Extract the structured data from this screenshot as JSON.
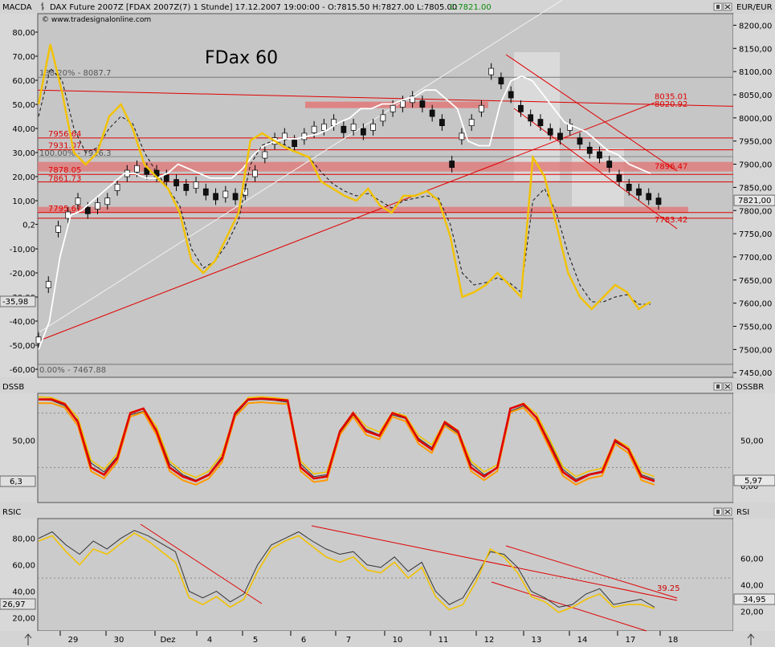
{
  "window": {
    "title_left": "MACDA",
    "title": "DAX Future 2007Z [FDAX 2007Z(7)  1 Stunde] 17.12.2007 19:00:00 - O:7815.50 H:7827.00 L:7805.00",
    "close_label": "C:7821.00",
    "website": "© www.tradesignalonline.com",
    "chart_label": "FDax 60",
    "right_header": "EUR/EUR"
  },
  "colors": {
    "price_bg": "#c6c6c6",
    "panel_bg": "#cbcbcb",
    "axis_bg": "#d8d8d8",
    "yellow": "#f2c200",
    "orange": "#ff9a00",
    "red": "#e00000",
    "white": "#ffffff",
    "black": "#000000",
    "band": "#e07878"
  },
  "chart_data": [
    {
      "type": "line",
      "panel": "price",
      "left_axis": [
        "80,00",
        "70,00",
        "60,00",
        "50,00",
        "40,00",
        "30,00",
        "20,00",
        "10,00",
        "0,2",
        "-10,00",
        "-20,00",
        "-30,00",
        "-40,00",
        "-50,00",
        "-60,00"
      ],
      "left_marker": "-35,98",
      "right_axis": [
        "8200,00",
        "8150,00",
        "8100,00",
        "8050,00",
        "8000,00",
        "7950,00",
        "7900,00",
        "7850,00",
        "7800,00",
        "7750,00",
        "7700,00",
        "7650,00",
        "7600,00",
        "7550,00",
        "7500,00",
        "7450,00"
      ],
      "right_marker": "7821,00",
      "ylim": [
        7440,
        8225
      ],
      "levels": [
        {
          "label": "138.20% - 8087.7",
          "value": 8087.7
        },
        {
          "label": "8035.01",
          "value": 8035.01
        },
        {
          "label": "8020.92",
          "value": 8020.92
        },
        {
          "label": "7956.64",
          "value": 7956.64
        },
        {
          "label": "7931.07",
          "value": 7931.07
        },
        {
          "label": "7896.47",
          "value": 7896.47
        },
        {
          "label": "100.00% - 7916.3",
          "value": 7916.3
        },
        {
          "label": "7878.05",
          "value": 7878.05
        },
        {
          "label": "7861.73",
          "value": 7861.73
        },
        {
          "label": "7795.67",
          "value": 7795.67
        },
        {
          "label": "7783.42",
          "value": 7783.42
        },
        {
          "label": "0.00% - 7467.88",
          "value": 7467.88
        }
      ],
      "series": [
        {
          "values": [
            7520,
            7640,
            7760,
            7790,
            7820,
            7800,
            7810,
            7820,
            7850,
            7880,
            7890,
            7885,
            7880,
            7870,
            7860,
            7850,
            7855,
            7840,
            7830,
            7835,
            7830,
            7840,
            7880,
            7920,
            7950,
            7960,
            7945,
            7960,
            7975,
            7980,
            7990,
            7975,
            7980,
            7970,
            7980,
            8000,
            8020,
            8030,
            8040,
            8030,
            8010,
            7990,
            7900,
            7960,
            7990,
            8020,
            8100,
            8080,
            8050,
            8020,
            8000,
            7990,
            7970,
            7960,
            7980,
            7950,
            7930,
            7920,
            7900,
            7870,
            7850,
            7840,
            7830,
            7820
          ]
        },
        {
          "values": [
            7500,
            7560,
            7700,
            7790,
            7800,
            7820,
            7840,
            7860,
            7880,
            7880,
            7870,
            7870,
            7880,
            7900,
            7890,
            7880,
            7870,
            7870,
            7870,
            7890,
            7920,
            7940,
            7950,
            7955,
            7955,
            7960,
            7965,
            7975,
            7990,
            8000,
            8020,
            8020,
            8030,
            8030,
            8040,
            8045,
            8060,
            8060,
            8040,
            8020,
            7950,
            7940,
            7940,
            8030,
            8080,
            8090,
            8080,
            8050,
            8020,
            7990,
            7980,
            7970,
            7950,
            7930,
            7920,
            7900,
            7890,
            7880
          ]
        },
        {
          "values": [
            50,
            75,
            55,
            30,
            25,
            30,
            45,
            50,
            40,
            25,
            20,
            15,
            5,
            -15,
            -20,
            -15,
            -5,
            5,
            35,
            38,
            35,
            32,
            30,
            28,
            18,
            15,
            12,
            10,
            15,
            8,
            5,
            12,
            12,
            14,
            10,
            -5,
            -30,
            -28,
            -25,
            -20,
            -25,
            -30,
            28,
            20,
            0,
            -20,
            -30,
            -35,
            -30,
            -25,
            -28,
            -35,
            -32
          ]
        },
        {
          "values": [
            45,
            65,
            60,
            40,
            30,
            32,
            40,
            45,
            42,
            30,
            22,
            15,
            8,
            -10,
            -18,
            -15,
            -8,
            2,
            25,
            33,
            35,
            33,
            30,
            28,
            22,
            17,
            14,
            12,
            13,
            10,
            7,
            10,
            11,
            12,
            11,
            0,
            -20,
            -25,
            -24,
            -22,
            -24,
            -28,
            10,
            15,
            5,
            -12,
            -25,
            -32,
            -32,
            -30,
            -29,
            -33,
            -33
          ]
        }
      ]
    },
    {
      "type": "line",
      "panel": "DSSB",
      "title": "DSSB",
      "right_title": "DSSBR",
      "left_axis": [
        "50,00"
      ],
      "left_marker": "6,3",
      "right_axis": [
        "50,00",
        "0,00"
      ],
      "right_marker": "5,97",
      "ylim": [
        0,
        100
      ],
      "series": [
        {
          "values": [
            95,
            95,
            90,
            70,
            20,
            12,
            30,
            80,
            85,
            60,
            20,
            10,
            5,
            12,
            30,
            80,
            95,
            96,
            95,
            94,
            20,
            8,
            10,
            60,
            80,
            60,
            55,
            80,
            75,
            50,
            40,
            70,
            60,
            20,
            10,
            20,
            85,
            90,
            75,
            45,
            15,
            5,
            12,
            15,
            50,
            40,
            10,
            5
          ]
        },
        {
          "values": [
            95,
            94,
            88,
            72,
            25,
            15,
            32,
            78,
            82,
            62,
            24,
            12,
            6,
            13,
            32,
            78,
            94,
            95,
            94,
            92,
            24,
            10,
            12,
            58,
            78,
            62,
            56,
            78,
            74,
            52,
            42,
            68,
            58,
            24,
            12,
            20,
            82,
            88,
            76,
            48,
            18,
            7,
            13,
            16,
            48,
            40,
            12,
            7
          ]
        }
      ]
    },
    {
      "type": "line",
      "panel": "RSI",
      "title": "RSIC",
      "right_title": "RSI",
      "left_axis": [
        "80,00",
        "60,00",
        "40,00",
        "20,00"
      ],
      "left_marker": "26,97",
      "right_axis": [
        "60,00",
        "40,00",
        "20,00"
      ],
      "right_marker": "34,95",
      "label_value": "39.25",
      "ylim": [
        10,
        95
      ],
      "series": [
        {
          "values": [
            80,
            85,
            75,
            68,
            78,
            72,
            80,
            86,
            82,
            76,
            70,
            40,
            35,
            40,
            32,
            38,
            60,
            75,
            80,
            85,
            78,
            72,
            68,
            70,
            60,
            58,
            66,
            55,
            62,
            40,
            30,
            35,
            52,
            70,
            68,
            58,
            40,
            35,
            28,
            30,
            38,
            42,
            30,
            32,
            34,
            28
          ]
        },
        {
          "values": [
            78,
            82,
            70,
            60,
            72,
            68,
            76,
            84,
            78,
            70,
            62,
            35,
            30,
            36,
            28,
            34,
            55,
            72,
            78,
            82,
            74,
            66,
            62,
            66,
            56,
            54,
            62,
            50,
            58,
            36,
            26,
            30,
            48,
            72,
            66,
            54,
            36,
            32,
            24,
            28,
            34,
            38,
            28,
            30,
            30,
            27
          ]
        }
      ]
    }
  ],
  "x_axis": [
    "29",
    "30",
    "Dez",
    "4",
    "5",
    "6",
    "7",
    "10",
    "11",
    "12",
    "13",
    "14",
    "17",
    "18"
  ]
}
